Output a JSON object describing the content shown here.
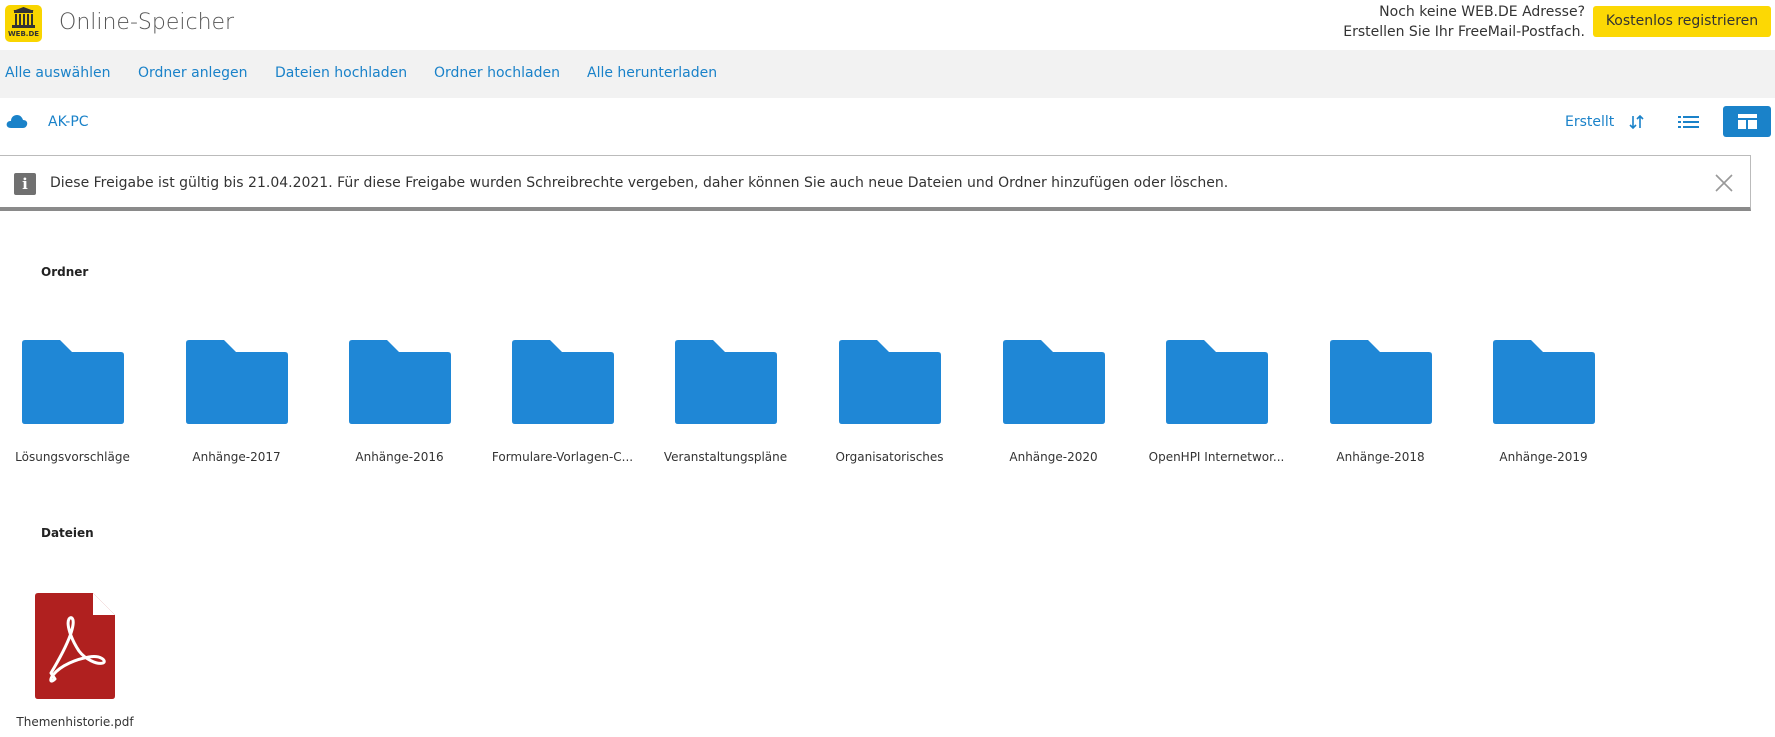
{
  "header": {
    "logo_text": "WEB.DE",
    "app_title": "Online-Speicher",
    "promo_line1": "Noch keine WEB.DE Adresse?",
    "promo_line2": "Erstellen Sie Ihr FreeMail-Postfach.",
    "register_label": "Kostenlos registrieren"
  },
  "toolbar": {
    "select_all": "Alle auswählen",
    "new_folder": "Ordner anlegen",
    "upload_files": "Dateien hochladen",
    "upload_folder": "Ordner hochladen",
    "download_all": "Alle herunterladen"
  },
  "breadcrumb": {
    "location": "AK-PC",
    "sort_label": "Erstellt"
  },
  "notice": {
    "text": "Diese Freigabe ist gültig bis 21.04.2021. Für diese Freigabe wurden Schreibrechte vergeben, daher können Sie auch neue Dateien und Ordner hinzufügen oder löschen."
  },
  "sections": {
    "folders_title": "Ordner",
    "files_title": "Dateien"
  },
  "folders": [
    "Lösungsvorschläge",
    "Anhänge-2017",
    "Anhänge-2016",
    "Formulare-Vorlagen-C...",
    "Veranstaltungspläne",
    "Organisatorisches",
    "Anhänge-2020",
    "OpenHPI Internetwor...",
    "Anhänge-2018",
    "Anhänge-2019"
  ],
  "files": [
    {
      "name": "Themenhistorie.pdf",
      "icon": "pdf-icon"
    }
  ],
  "colors": {
    "accent": "#1a82c9",
    "folder": "#1f87d6",
    "register": "#fcd804",
    "pdf": "#b0201f"
  }
}
